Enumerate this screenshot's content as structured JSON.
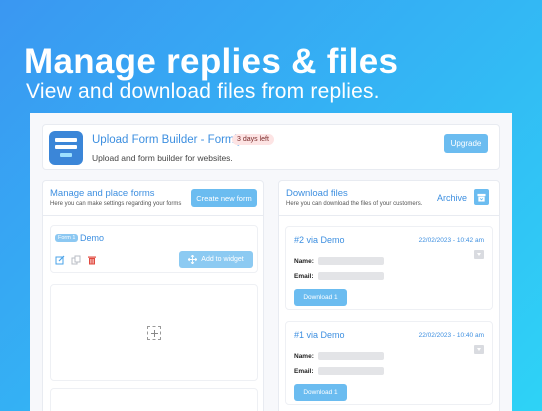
{
  "hero": {
    "title": "Manage replies & files",
    "subtitle": "View and download files from replies."
  },
  "app": {
    "name": "Upload Form Builder - Formly",
    "trial_badge": "3 days left",
    "description": "Upload and form builder for websites.",
    "upgrade_label": "Upgrade"
  },
  "forms_panel": {
    "title": "Manage and place forms",
    "subtitle": "Here you can make settings regarding your forms",
    "create_label": "Create new form",
    "form": {
      "badge": "Form 1",
      "name": "Demo",
      "add_widget_label": "Add to widget"
    }
  },
  "files_panel": {
    "title": "Download files",
    "subtitle": "Here you can download the files of your customers.",
    "archive_label": "Archive",
    "replies": [
      {
        "title": "#2 via Demo",
        "date": "22/02/2023 - 10:42 am",
        "name_label": "Name:",
        "email_label": "Email:",
        "download_label": "Download 1"
      },
      {
        "title": "#1 via Demo",
        "date": "22/02/2023 - 10:40 am",
        "name_label": "Name:",
        "email_label": "Email:",
        "download_label": "Download 1"
      }
    ]
  },
  "colors": {
    "accent": "#3d8fe0",
    "button": "#6bbcf0",
    "badge_bg": "#fde4e4",
    "delete_icon": "#e0483e"
  },
  "icons": {
    "app_logo": "form-builder-logo",
    "edit": "edit-icon",
    "copy": "copy-icon",
    "delete": "trash-icon",
    "move": "move-icon",
    "archive": "archive-icon",
    "download": "download-icon",
    "add_element": "add-element-icon"
  }
}
